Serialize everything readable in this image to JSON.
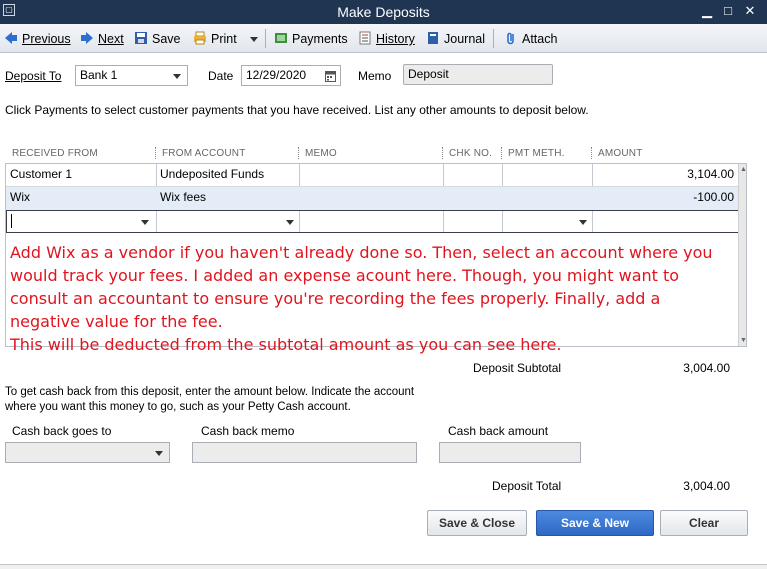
{
  "window": {
    "title": "Make Deposits"
  },
  "toolbar": {
    "previous": "Previous",
    "next": "Next",
    "save": "Save",
    "print": "Print",
    "payments": "Payments",
    "history": "History",
    "journal": "Journal",
    "attach": "Attach"
  },
  "header": {
    "deposit_to_label": "Deposit To",
    "deposit_to_value": "Bank 1",
    "date_label": "Date",
    "date_value": "12/29/2020",
    "memo_label": "Memo",
    "memo_value": "Deposit"
  },
  "instructions": "Click Payments to select customer payments that you have received. List any other amounts to deposit below.",
  "grid": {
    "columns": [
      "RECEIVED FROM",
      "FROM ACCOUNT",
      "MEMO",
      "CHK NO.",
      "PMT METH.",
      "AMOUNT"
    ],
    "rows": [
      {
        "received_from": "Customer 1",
        "from_account": "Undeposited Funds",
        "memo": "",
        "chk_no": "",
        "pmt_meth": "",
        "amount": "3,104.00"
      },
      {
        "received_from": "Wix",
        "from_account": "Wix fees",
        "memo": "",
        "chk_no": "",
        "pmt_meth": "",
        "amount": "-100.00"
      }
    ]
  },
  "annotation": {
    "line1": "Add Wix as a vendor if you haven't already done so. Then, select an account where you would track your fees. I added an expense acount here. Though, you might want to consult an accountant to ensure you're recording the fees properly. Finally, add a negative value for the fee.",
    "line2": "This will be deducted from the subtotal amount as you can see here."
  },
  "subtotal": {
    "label": "Deposit Subtotal",
    "value": "3,004.00"
  },
  "cashback": {
    "instructions_line1": "To get cash back from this deposit, enter the amount below.  Indicate the account",
    "instructions_line2": "where you want this money to go, such as your Petty Cash account.",
    "goes_to_label": "Cash back goes to",
    "memo_label": "Cash back memo",
    "amount_label": "Cash back amount"
  },
  "total": {
    "label": "Deposit Total",
    "value": "3,004.00"
  },
  "buttons": {
    "save_close": "Save & Close",
    "save_new": "Save & New",
    "clear": "Clear"
  },
  "colors": {
    "titlebar": "#1f3552",
    "annotation": "#e0141e",
    "primary_button": "#2e68c5"
  }
}
